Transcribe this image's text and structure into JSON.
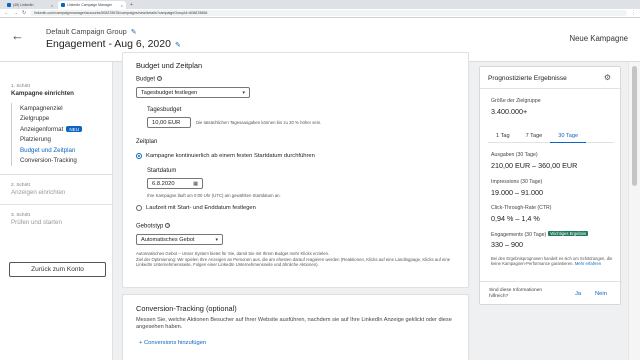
{
  "browser": {
    "tabs": [
      {
        "label": "(45) LinkedIn",
        "active": false
      },
      {
        "label": "LinkedIn Campaign Manager",
        "active": true
      }
    ],
    "new_tab": "+",
    "url": "linkedin.com/campaignmanager/accounts/508378576/campaigns/new/details?campaignGroupId=608878856"
  },
  "header": {
    "campaign_group": "Default Campaign Group",
    "campaign_name": "Engagement - Aug 6, 2020",
    "new_campaign": "Neue Kampagne"
  },
  "sidebar": {
    "step1_label": "1. Schritt",
    "step1_title": "Kampagne einrichten",
    "items": [
      {
        "label": "Kampagnenziel",
        "active": false
      },
      {
        "label": "Zielgruppe",
        "active": false
      },
      {
        "label": "Anzeigenformat",
        "active": false,
        "badge": "NEU"
      },
      {
        "label": "Platzierung",
        "active": false
      },
      {
        "label": "Budget und Zeitplan",
        "active": true
      },
      {
        "label": "Conversion-Tracking",
        "active": false
      }
    ],
    "step2_label": "2. Schritt",
    "step2_title": "Anzeigen einrichten",
    "step3_label": "3. Schritt",
    "step3_title": "Prüfen und starten",
    "back_button": "Zurück zum Konto"
  },
  "budget": {
    "section_title": "Budget und Zeitplan",
    "budget_label": "Budget",
    "budget_type": "Tagesbudget festlegen",
    "daily_label": "Tagesbudget",
    "daily_value": "10,00 EUR",
    "daily_note": "Die tatsächlichen Tagesausgaben können bis zu 20 % höher sein.",
    "schedule_label": "Zeitplan",
    "radio_continuous": "Kampagne kontinuierlich ab einem festen Startdatum durchführen",
    "start_label": "Startdatum",
    "start_value": "6.8.2020",
    "start_note": "Ihre Kampagne läuft um 0:00 Uhr (UTC) am gewählten Startdatum an.",
    "radio_range": "Laufzeit mit Start- und Enddatum festlegen",
    "bid_label": "Gebotstyp",
    "bid_value": "Automatisches Gebot",
    "bid_note_1": "Automatisches Gebot – Unser System bietet für Sie, damit Sie mit Ihrem Budget mehr Klicks erzielen.",
    "bid_note_2": "Ziel der Optimierung: Wir spielen Ihre Anzeigen an Personen aus, die am ehesten darauf reagieren werden (Reaktionen, Klicks auf eine Landingpage, Klicks auf eine LinkedIn Unternehmensseite, Folgen einer LinkedIn Unternehmensseite und ähnliche Aktionen)."
  },
  "conversion": {
    "title": "Conversion-Tracking (optional)",
    "description": "Messen Sie, welche Aktionen Besucher auf Ihrer Website ausführen, nachdem sie auf Ihre LinkedIn Anzeige geklickt oder diese angesehen haben.",
    "add_link": "+ Conversions hinzufügen"
  },
  "forecast": {
    "title": "Prognostizierte Ergebnisse",
    "audience_label": "Größe der Zielgruppe",
    "audience_value": "3.400.000+",
    "tabs": [
      {
        "label": "1 Tag",
        "active": false
      },
      {
        "label": "7 Tage",
        "active": false
      },
      {
        "label": "30 Tage",
        "active": true
      }
    ],
    "spend_label": "Ausgaben (30 Tage)",
    "spend_value": "210,00 EUR – 360,00 EUR",
    "impressions_label": "Impressions (30 Tage)",
    "impressions_value": "19.000 – 91.000",
    "ctr_label": "Click-Through-Rate (CTR)",
    "ctr_value": "0,94 % – 1,4 %",
    "engagements_label": "Engagements (30 Tage)",
    "engagements_badge": "Wichtiges Ergebnis",
    "engagements_value": "330 – 900",
    "note": "Bei den Ergebnisprognosen handelt es sich um Schätzungen, die keine Kampagnen-Performance garantieren.",
    "note_link": "Mehr erfahren",
    "helpful_question": "Sind diese Informationen hilfreich?",
    "yes": "Ja",
    "no": "Nein"
  }
}
